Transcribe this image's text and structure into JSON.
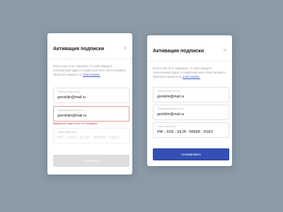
{
  "colors": {
    "background": "#8a9aa6",
    "accent": "#3450b4",
    "error": "#d9363e",
    "disabled_button": "#dedede"
  },
  "left_dialog": {
    "title": "Активация подписки",
    "close_icon": "close-icon",
    "description": "Если у вас есть подписка, то тоже введите электронный адрес и секретный ключ. Восстановить свой ключ можете по",
    "link": "этой ссылке.",
    "field1": {
      "label": "Электронная почта",
      "value": "gonokitin@mail.ru"
    },
    "field2": {
      "label": "Подтверждение почты",
      "value": "goonikitin@mail.ru",
      "error": "Введенные вами почты не совпадают"
    },
    "field3": {
      "label": "Секретный ключ",
      "value": "HW - JIOE - EKJR - MWER - KSEV"
    },
    "button": "Активировать"
  },
  "right_dialog": {
    "title": "Активация подписки",
    "close_icon": "close-icon",
    "description": "Если у вас есть подписка, то тоже введите электронный адрес и секретный ключ. Восстановить свой ключ можете по",
    "link": "этой ссылке.",
    "field1": {
      "label": "Электронная почта",
      "value": "gonikitin@mail.ru"
    },
    "field2": {
      "label": "Подтверждение почты",
      "value": "gonikitin@mail.ru"
    },
    "field3": {
      "label": "Секретный ключ",
      "value": "HW - JIOE - EKJR - MWER - KSEV"
    },
    "button": "Активировать"
  }
}
